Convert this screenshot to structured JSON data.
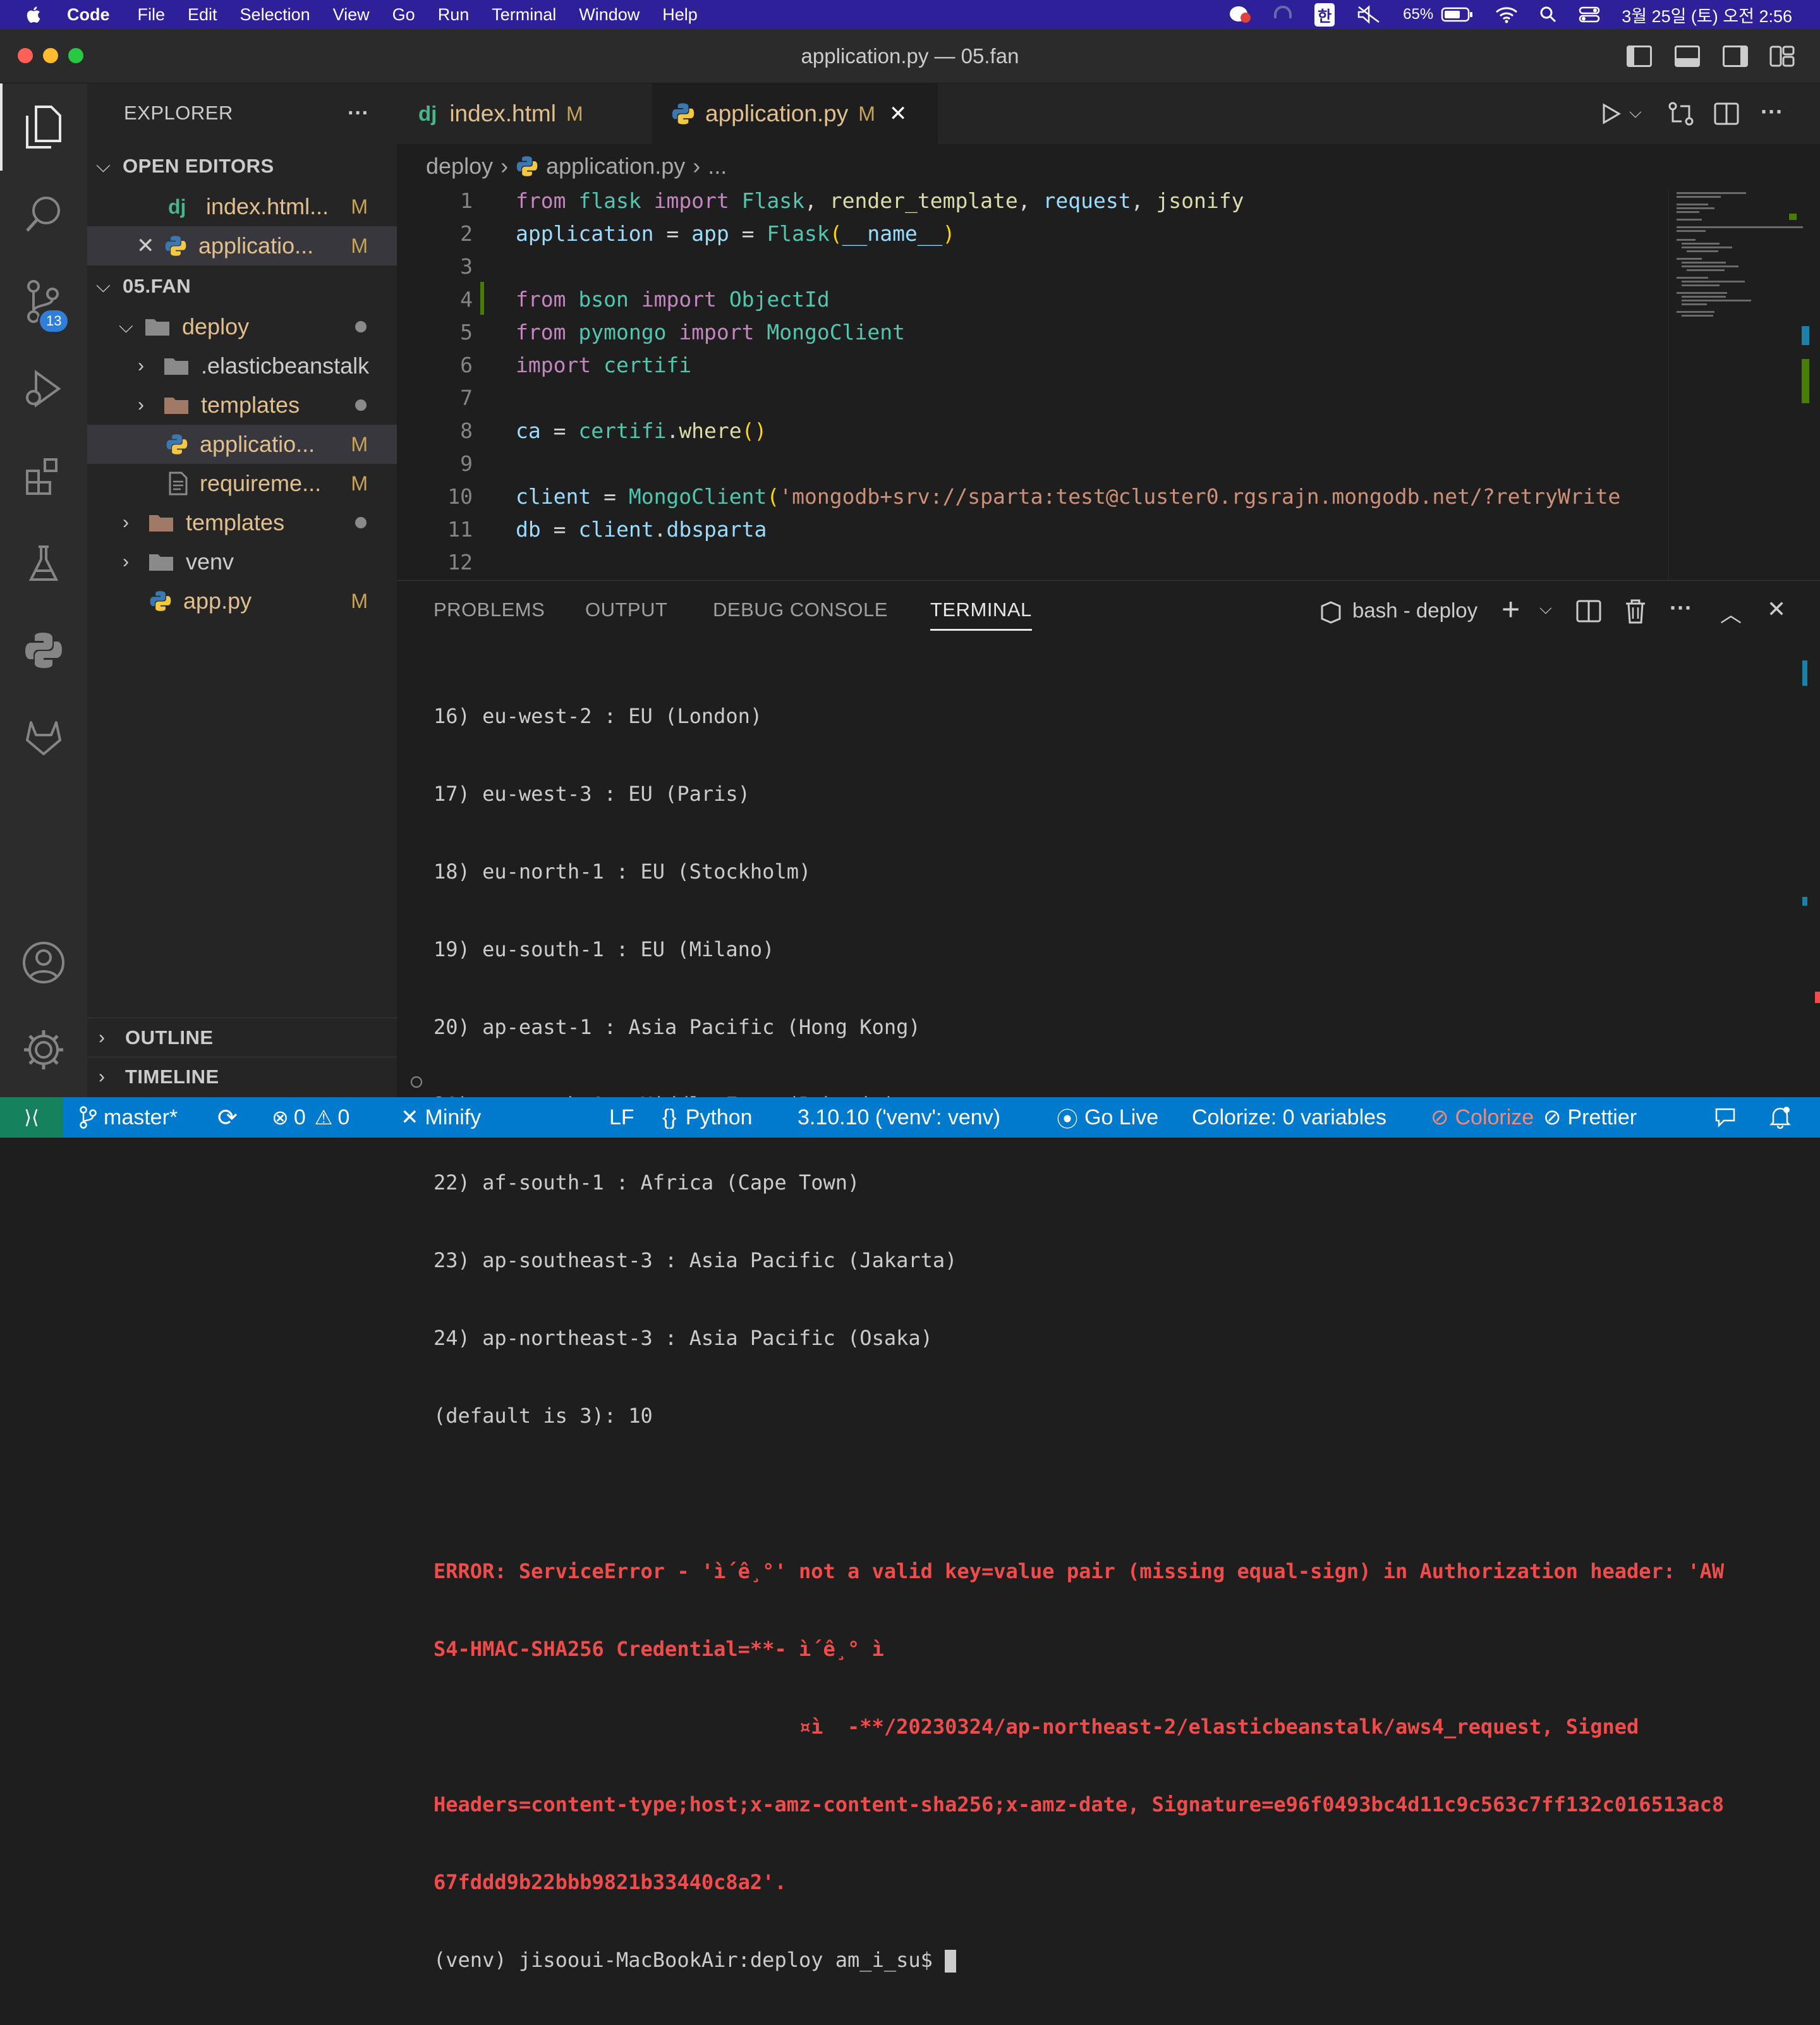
{
  "menubar": {
    "app": "Code",
    "items": [
      "File",
      "Edit",
      "Selection",
      "View",
      "Go",
      "Run",
      "Terminal",
      "Window",
      "Help"
    ],
    "battery": "65%",
    "input_method": "한",
    "clock": "3월 25일 (토) 오전 2:56"
  },
  "window": {
    "title": "application.py — 05.fan"
  },
  "activity": {
    "scm_badge": "13"
  },
  "sidebar": {
    "explorer_title": "EXPLORER",
    "more": "···",
    "open_editors_title": "OPEN EDITORS",
    "open_editors": [
      {
        "icon": "dj",
        "name": "index.html...",
        "status": "M"
      },
      {
        "name": "applicatio...",
        "status": "M"
      }
    ],
    "project_title": "05.FAN",
    "tree": [
      {
        "name": "deploy"
      },
      {
        "name": ".elasticbeanstalk"
      },
      {
        "name": "templates"
      },
      {
        "name": "applicatio...",
        "status": "M"
      },
      {
        "name": "requireme...",
        "status": "M"
      },
      {
        "name": "templates"
      },
      {
        "name": "venv"
      },
      {
        "name": "app.py",
        "status": "M"
      }
    ],
    "outline_title": "OUTLINE",
    "timeline_title": "TIMELINE"
  },
  "tabs": [
    {
      "icon": "dj",
      "label": "index.html",
      "status": "M"
    },
    {
      "label": "application.py",
      "status": "M"
    }
  ],
  "breadcrumb": {
    "folder": "deploy",
    "file": "application.py",
    "more": "..."
  },
  "code_lines": {
    "l1": {
      "a": "from",
      "b": "flask",
      "c": "import",
      "d": "Flask",
      "e": ", ",
      "f": "render_template",
      "g": ", ",
      "h": "request",
      "i": ", ",
      "j": "jsonify"
    },
    "l2": {
      "a": "application",
      "b": " = ",
      "c": "app",
      "d": " = ",
      "e": "Flask",
      "f": "(",
      "g": "__name__",
      "h": ")"
    },
    "l4": {
      "a": "from",
      "b": "bson",
      "c": "import",
      "d": "ObjectId"
    },
    "l5": {
      "a": "from",
      "b": "pymongo",
      "c": "import",
      "d": "MongoClient"
    },
    "l6": {
      "a": "import",
      "b": "certifi"
    },
    "l8": {
      "a": "ca",
      "b": " = ",
      "c": "certifi",
      "d": ".",
      "e": "where",
      "f": "()"
    },
    "l10": {
      "a": "client",
      "b": " = ",
      "c": "MongoClient",
      "d": "(",
      "e": "'mongodb+srv://sparta:test@cluster0.rgsrajn.mongodb.net/?retryWrite"
    },
    "l11": {
      "a": "db",
      "b": " = ",
      "c": "client",
      "d": ".",
      "e": "dbsparta"
    }
  },
  "line_numbers": [
    "1",
    "2",
    "3",
    "4",
    "5",
    "6",
    "7",
    "8",
    "9",
    "10",
    "11",
    "12"
  ],
  "panel": {
    "tabs": [
      "PROBLEMS",
      "OUTPUT",
      "DEBUG CONSOLE",
      "TERMINAL"
    ],
    "shell": "bash - deploy",
    "terminal_lines": [
      "16) eu-west-2 : EU (London)",
      "17) eu-west-3 : EU (Paris)",
      "18) eu-north-1 : EU (Stockholm)",
      "19) eu-south-1 : EU (Milano)",
      "20) ap-east-1 : Asia Pacific (Hong Kong)",
      "21) me-south-1 : Middle East (Bahrain)",
      "22) af-south-1 : Africa (Cape Town)",
      "23) ap-southeast-3 : Asia Pacific (Jakarta)",
      "24) ap-northeast-3 : Asia Pacific (Osaka)",
      "(default is 3): 10"
    ],
    "error_lines": [
      "ERROR: ServiceError - 'ì´ê¸°' not a valid key=value pair (missing equal-sign) in Authorization header: 'AW",
      "S4-HMAC-SHA256 Credential=**- ì´ê¸° ì",
      "                              ¤ì  -**/20230324/ap-northeast-2/elasticbeanstalk/aws4_request, Signed",
      "Headers=content-type;host;x-amz-content-sha256;x-amz-date, Signature=e96f0493bc4d11c9c563c7ff132c016513ac8",
      "67fddd9b22bbb9821b33440c8a2'."
    ],
    "prompt": "(venv) jisooui-MacBookAir:deploy am_i_su$ "
  },
  "statusbar": {
    "branch": "master*",
    "errors": "0",
    "warnings": "0",
    "minify": "Minify",
    "eol": "LF",
    "language": "Python",
    "interpreter": "3.10.10 ('venv': venv)",
    "golive": "Go Live",
    "colorize_vars": "Colorize: 0 variables",
    "colorize": "Colorize",
    "prettier": "Prettier"
  },
  "colors": {
    "menubar": "#2e2098",
    "statusbar": "#007acc",
    "remote": "#16825d",
    "error_text": "#f14c4c",
    "modified": "#e2c08d"
  }
}
